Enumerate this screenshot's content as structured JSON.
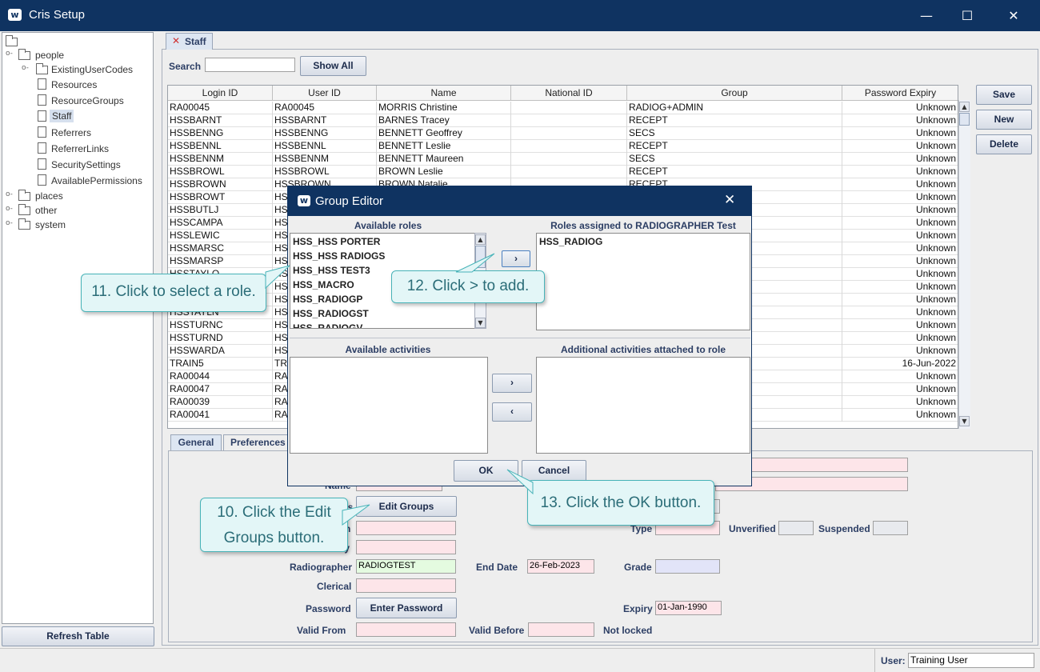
{
  "window": {
    "title": "Cris Setup",
    "min": "—",
    "max": "☐",
    "close": "✕"
  },
  "tree": {
    "nodes": [
      "people",
      "ExistingUserCodes",
      "Resources",
      "ResourceGroups",
      "Staff",
      "Referrers",
      "ReferrerLinks",
      "SecuritySettings",
      "AvailablePermissions",
      "places",
      "other",
      "system"
    ],
    "refresh": "Refresh Table"
  },
  "tab": {
    "label": "Staff"
  },
  "search": {
    "label": "Search",
    "value": "",
    "show_all": "Show All"
  },
  "actions": {
    "save": "Save",
    "new": "New",
    "delete": "Delete"
  },
  "table": {
    "columns": [
      "Login ID",
      "User ID",
      "Name",
      "National ID",
      "Group",
      "Password Expiry"
    ],
    "rows": [
      [
        "RA00045",
        "RA00045",
        "MORRIS Christine",
        "",
        "RADIOG+ADMIN",
        "Unknown"
      ],
      [
        "HSSBARNT",
        "HSSBARNT",
        "BARNES Tracey",
        "",
        "RECEPT",
        "Unknown"
      ],
      [
        "HSSBENNG",
        "HSSBENNG",
        "BENNETT Geoffrey",
        "",
        "SECS",
        "Unknown"
      ],
      [
        "HSSBENNL",
        "HSSBENNL",
        "BENNETT Leslie",
        "",
        "RECEPT",
        "Unknown"
      ],
      [
        "HSSBENNM",
        "HSSBENNM",
        "BENNETT Maureen",
        "",
        "SECS",
        "Unknown"
      ],
      [
        "HSSBROWL",
        "HSSBROWL",
        "BROWN Leslie",
        "",
        "RECEPT",
        "Unknown"
      ],
      [
        "HSSBROWN",
        "HSSBROWN",
        "BROWN Natalie",
        "",
        "RECEPT",
        "Unknown"
      ],
      [
        "HSSBROWT",
        "HS",
        "",
        "",
        "",
        "Unknown"
      ],
      [
        "HSSBUTLJ",
        "HS",
        "",
        "",
        "",
        "Unknown"
      ],
      [
        "HSSCAMPA",
        "HS",
        "",
        "",
        "",
        "Unknown"
      ],
      [
        "HSSLEWIC",
        "HS",
        "",
        "",
        "",
        "Unknown"
      ],
      [
        "HSSMARSC",
        "HS",
        "",
        "",
        "",
        "Unknown"
      ],
      [
        "HSSMARSP",
        "HS",
        "",
        "",
        "",
        "Unknown"
      ],
      [
        "HSSTAYLO",
        "HS",
        "",
        "",
        "",
        "Unknown"
      ],
      [
        "HSSTURNB",
        "HS",
        "",
        "",
        "",
        "Unknown"
      ],
      [
        "HSSTURND",
        "HS",
        "",
        "",
        "",
        "Unknown"
      ],
      [
        "HSSTAYLN",
        "HS",
        "",
        "",
        "",
        "Unknown"
      ],
      [
        "HSSTURNC",
        "HS",
        "",
        "",
        "",
        "Unknown"
      ],
      [
        "HSSTURND",
        "HS",
        "",
        "",
        "",
        "Unknown"
      ],
      [
        "HSSWARDA",
        "HS",
        "",
        "",
        "",
        "Unknown"
      ],
      [
        "TRAIN5",
        "TRA",
        "",
        "",
        "",
        "16-Jun-2022"
      ],
      [
        "RA00044",
        "RA",
        "",
        "",
        "",
        "Unknown"
      ],
      [
        "RA00047",
        "RA",
        "",
        "",
        "",
        "Unknown"
      ],
      [
        "RA00039",
        "RA",
        "",
        "",
        "",
        "Unknown"
      ],
      [
        "RA00041",
        "RA",
        "",
        "",
        "",
        "Unknown"
      ]
    ]
  },
  "detail": {
    "tabs": [
      "General",
      "Preferences"
    ],
    "name_label": "Name",
    "groups_label": "ups",
    "edit_groups": "Edit Groups",
    "rad_label": "Radiographer",
    "rad_value": "RADIOGTEST",
    "end_date_label": "End Date",
    "end_date": "26-Feb-2023",
    "grade_label": "Grade",
    "clerical_label": "Clerical",
    "password_label": "Password",
    "enter_password": "Enter Password",
    "expiry_label": "Expiry",
    "expiry": "01-Jan-1990",
    "valid_from_label": "Valid From",
    "valid_before_label": "Valid Before",
    "not_locked": "Not locked",
    "type_label": "Type",
    "unverified_label": "Unverified",
    "suspended_label": "Suspended",
    "clin_label": "ian",
    "sec_label": "ary"
  },
  "status": {
    "user_label": "User:",
    "user_value": "Training User"
  },
  "dialog": {
    "title": "Group Editor",
    "available_roles": "Available roles",
    "assigned_roles": "Roles assigned to RADIOGRAPHER Test",
    "roles": [
      "HSS_HSS PORTER",
      "HSS_HSS RADIOGS",
      "HSS_HSS TEST3",
      "HSS_MACRO",
      "HSS_RADIOGP",
      "HSS_RADIOGST",
      "HSS_RADIOGV"
    ],
    "assigned": [
      "HSS_RADIOG"
    ],
    "available_activities": "Available activities",
    "additional_activities": "Additional activities attached to role",
    "ok": "OK",
    "cancel": "Cancel"
  },
  "callouts": {
    "c10": "10. Click the Edit Groups button.",
    "c11": "11. Click to select a role.",
    "c12": "12. Click > to add.",
    "c13": "13. Click the OK button."
  }
}
